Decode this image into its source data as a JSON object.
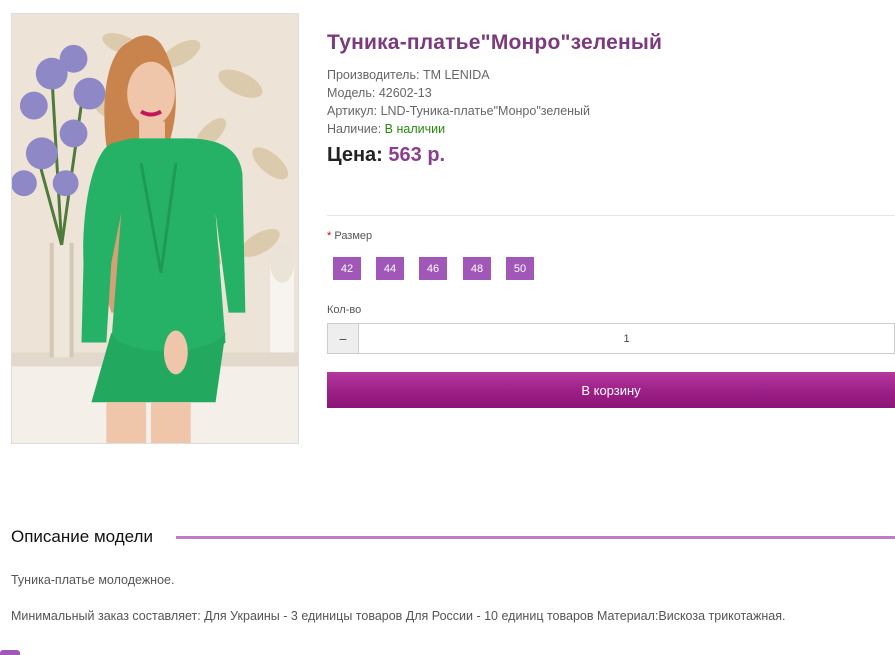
{
  "product": {
    "title": "Туника-платье\"Монро\"зеленый",
    "image_alt": "Туника-платье Монро зеленый",
    "manufacturer_label": "Производитель:",
    "manufacturer_value": "TM LENIDA",
    "model_label": "Модель:",
    "model_value": "42602-13",
    "sku_label": "Артикул:",
    "sku_value": "LND-Туника-платье\"Монро\"зеленый",
    "availability_label": "Наличие:",
    "availability_value": "В наличии",
    "price_label": "Цена:",
    "price_value": "563 р."
  },
  "options": {
    "size_required_mark": "*",
    "size_label": "Размер",
    "sizes": [
      "42",
      "44",
      "46",
      "48",
      "50"
    ]
  },
  "quantity": {
    "label": "Кол-во",
    "minus_symbol": "−",
    "value": "1"
  },
  "cart": {
    "button_label": "В корзину"
  },
  "description": {
    "title": "Описание модели",
    "paragraph1": "Туника-платье молодежное.",
    "paragraph2": "Минимальный заказ составляет: Для Украины - 3 единицы товаров Для России - 10 единиц товаров Материал:Вискоза трикотажная."
  },
  "colors": {
    "accent": "#a057b8",
    "title": "#7a3b7e",
    "price": "#8b3e8f",
    "cart_button": "#9c1f86",
    "in_stock": "#2a8a10",
    "section_line": "#c07ac9"
  }
}
